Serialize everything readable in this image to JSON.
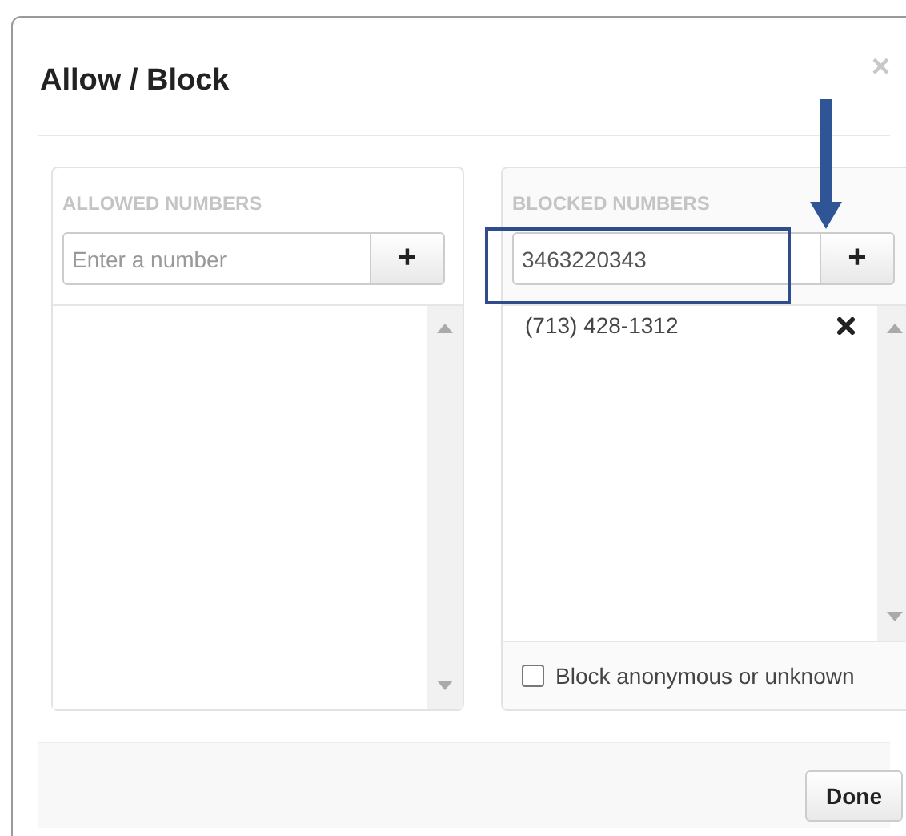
{
  "dialog": {
    "title": "Allow / Block",
    "close": "×"
  },
  "panels": [
    {
      "heading": "ALLOWED NUMBERS",
      "input": {
        "placeholder": "Enter a number"
      },
      "add_button": "+"
    },
    {
      "heading": "BLOCKED NUMBERS",
      "input": {
        "value": "3463220343"
      },
      "add_button": "+",
      "numbers": [
        "(713) 428-1312"
      ],
      "option": {
        "label": "Block anonymous or unknown",
        "checked": false
      }
    }
  ],
  "footer": {
    "done_button": "Done"
  }
}
